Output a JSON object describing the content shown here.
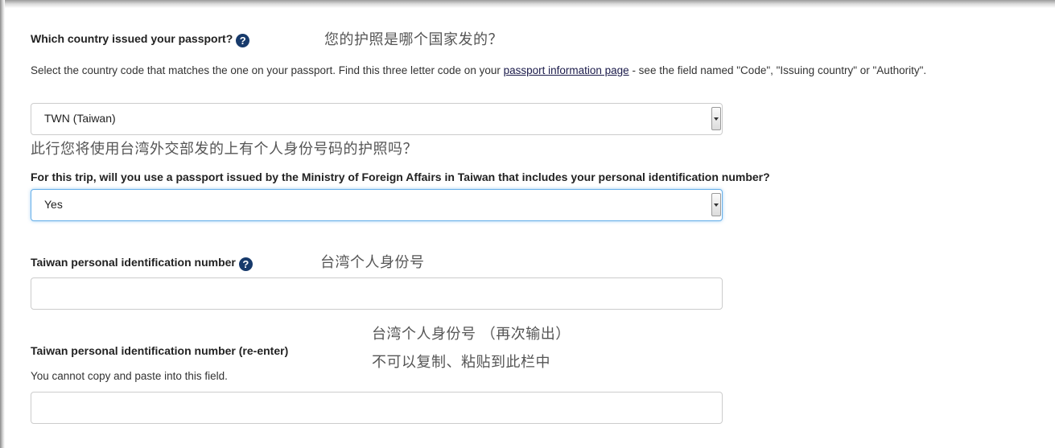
{
  "country_question": {
    "label": "Which country issued your passport?",
    "help_icon": "question-circle-icon",
    "translation": "您的护照是哪个国家发的？",
    "help_text_before": "Select the country code that matches the one on your passport.  Find this three letter code on your ",
    "help_link": "passport information page",
    "help_text_after": " - see the field named \"Code\", \"Issuing country\" or \"Authority\".",
    "selected_value": "TWN (Taiwan)"
  },
  "trip_question": {
    "translation": "此行您将使用台湾外交部发的上有个人身份号码的护照吗？",
    "label": "For this trip, will you use a passport issued by the Ministry of Foreign Affairs in Taiwan that includes your personal identification number?",
    "selected_value": "Yes"
  },
  "personal_id": {
    "label": "Taiwan personal identification number",
    "help_icon": "question-circle-icon",
    "translation": "台湾个人身份号",
    "value": ""
  },
  "personal_id_reenter": {
    "label": "Taiwan personal identification number (re-enter)",
    "help_text": "You cannot copy and paste into this field.",
    "translation_line1": "台湾个人身份号 （再次输出）",
    "translation_line2": "不可以复制、粘贴到此栏中",
    "value": ""
  },
  "colors": {
    "help_icon": "#173a6b",
    "focus_border": "#66afe9"
  }
}
